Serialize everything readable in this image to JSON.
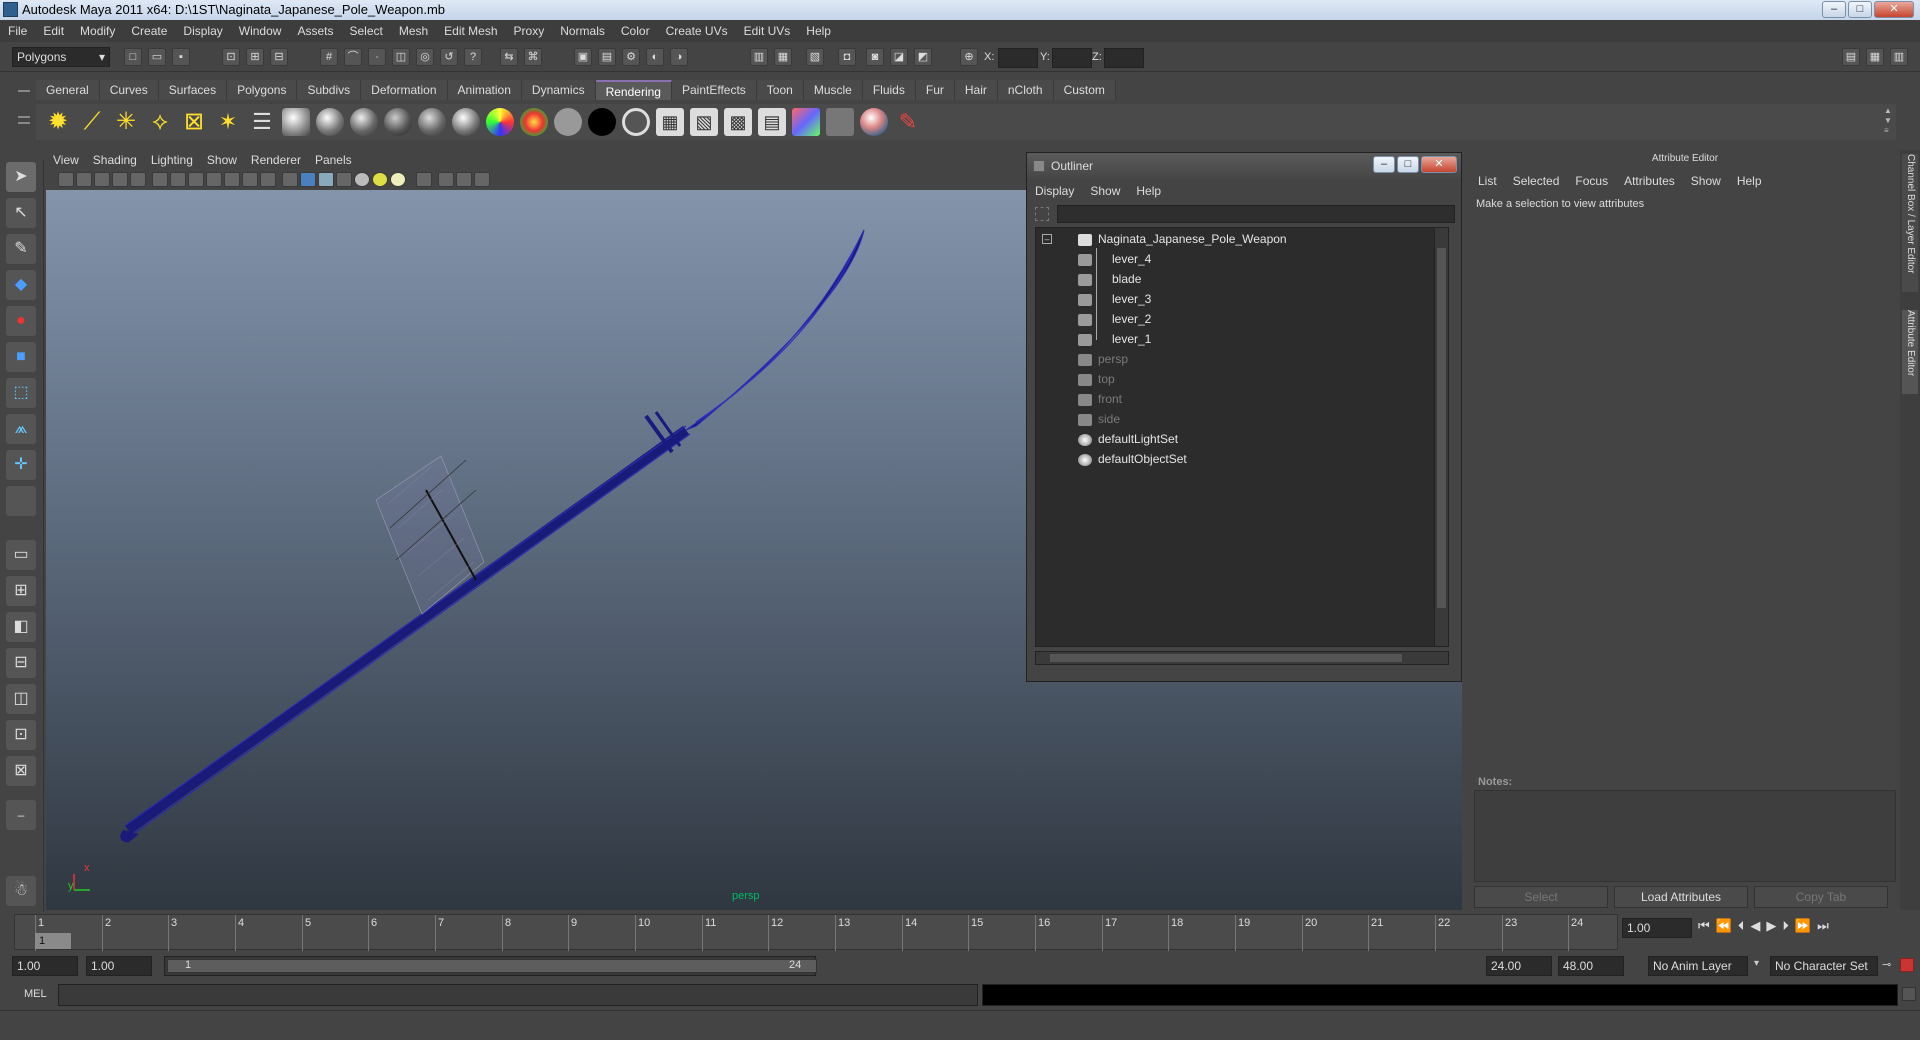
{
  "window": {
    "title": "Autodesk Maya 2011 x64: D:\\1ST\\Naginata_Japanese_Pole_Weapon.mb"
  },
  "menubar": [
    "File",
    "Edit",
    "Modify",
    "Create",
    "Display",
    "Window",
    "Assets",
    "Select",
    "Mesh",
    "Edit Mesh",
    "Proxy",
    "Normals",
    "Color",
    "Create UVs",
    "Edit UVs",
    "Help"
  ],
  "statusline": {
    "mode": "Polygons",
    "x_label": "X:",
    "y_label": "Y:",
    "z_label": "Z:"
  },
  "shelf": {
    "tabs": [
      "General",
      "Curves",
      "Surfaces",
      "Polygons",
      "Subdivs",
      "Deformation",
      "Animation",
      "Dynamics",
      "Rendering",
      "PaintEffects",
      "Toon",
      "Muscle",
      "Fluids",
      "Fur",
      "Hair",
      "nCloth",
      "Custom"
    ],
    "active_tab": "Rendering"
  },
  "viewport": {
    "menu": [
      "View",
      "Shading",
      "Lighting",
      "Show",
      "Renderer",
      "Panels"
    ],
    "camera_label": "persp",
    "axis_x": "x",
    "axis_y": "y"
  },
  "outliner": {
    "title": "Outliner",
    "menu": [
      "Display",
      "Show",
      "Help"
    ],
    "items": [
      {
        "label": "Naginata_Japanese_Pole_Weapon",
        "level": 0,
        "dim": false
      },
      {
        "label": "lever_4",
        "level": 1,
        "dim": false
      },
      {
        "label": "blade",
        "level": 1,
        "dim": false
      },
      {
        "label": "lever_3",
        "level": 1,
        "dim": false
      },
      {
        "label": "lever_2",
        "level": 1,
        "dim": false
      },
      {
        "label": "lever_1",
        "level": 1,
        "dim": false
      },
      {
        "label": "persp",
        "level": 0,
        "dim": true
      },
      {
        "label": "top",
        "level": 0,
        "dim": true
      },
      {
        "label": "front",
        "level": 0,
        "dim": true
      },
      {
        "label": "side",
        "level": 0,
        "dim": true
      },
      {
        "label": "defaultLightSet",
        "level": 0,
        "dim": false
      },
      {
        "label": "defaultObjectSet",
        "level": 0,
        "dim": false
      }
    ]
  },
  "attribute_editor": {
    "title": "Attribute Editor",
    "menu": [
      "List",
      "Selected",
      "Focus",
      "Attributes",
      "Show",
      "Help"
    ],
    "message": "Make a selection to view attributes",
    "notes_label": "Notes:",
    "buttons": [
      "Select",
      "Load Attributes",
      "Copy Tab"
    ],
    "side_tabs": [
      "Channel Box / Layer Editor",
      "Attribute Editor"
    ]
  },
  "timeline": {
    "ticks": [
      "1",
      "2",
      "3",
      "4",
      "5",
      "6",
      "7",
      "8",
      "9",
      "10",
      "11",
      "12",
      "13",
      "14",
      "15",
      "16",
      "17",
      "18",
      "19",
      "20",
      "21",
      "22",
      "23",
      "24"
    ],
    "current_frame_marker": "1",
    "current_time": "1.00"
  },
  "range": {
    "start": "1.00",
    "playback_start": "1.00",
    "slider_start": "1",
    "slider_end": "24",
    "playback_end": "24.00",
    "end": "48.00",
    "anim_layer": "No Anim Layer",
    "character_set": "No Character Set"
  },
  "command_line": {
    "label": "MEL"
  }
}
